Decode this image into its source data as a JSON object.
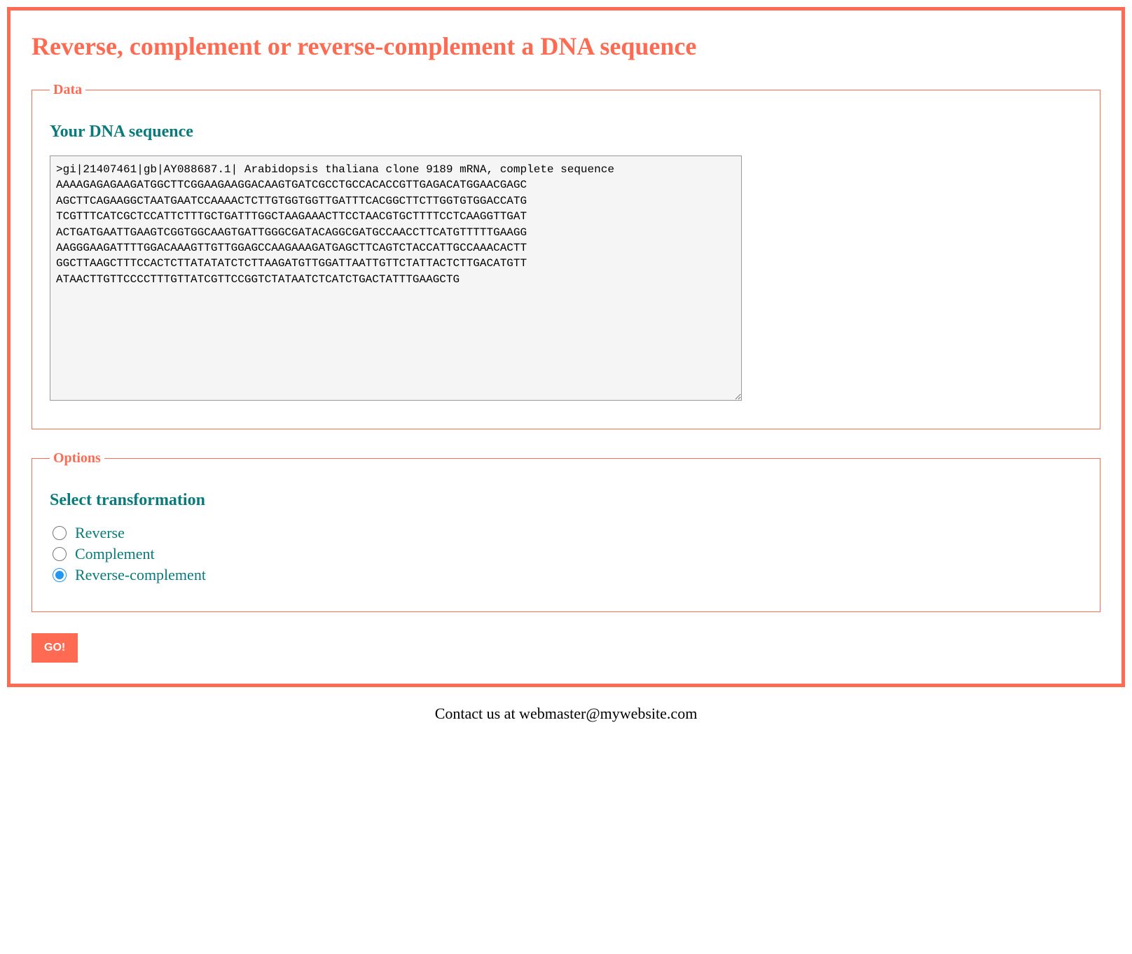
{
  "title": "Reverse, complement or reverse-complement a DNA sequence",
  "data_section": {
    "legend": "Data",
    "heading": "Your DNA sequence",
    "textarea_value": ">gi|21407461|gb|AY088687.1| Arabidopsis thaliana clone 9189 mRNA, complete sequence\nAAAAGAGAGAAGATGGCTTCGGAAGAAGGACAAGTGATCGCCTGCCACACCGTTGAGACATGGAACGAGC\nAGCTTCAGAAGGCTAATGAATCCAAAACTCTTGTGGTGGTTGATTTCACGGCTTCTTGGTGTGGACCATG\nTCGTTTCATCGCTCCATTCTTTGCTGATTTGGCTAAGAAACTTCCTAACGTGCTTTTCCTCAAGGTTGAT\nACTGATGAATTGAAGTCGGTGGCAAGTGATTGGGCGATACAGGCGATGCCAACCTTCATGTTTTTGAAGG\nAAGGGAAGATTTTGGACAAAGTTGTTGGAGCCAAGAAAGATGAGCTTCAGTCTACCATTGCCAAACACTT\nGGCTTAAGCTTTCCACTCTTATATATCTCTTAAGATGTTGGATTAATTGTTCTATTACTCTTGACATGTT\nATAACTTGTTCCCCTTTGTTATCGTTCCGGTCTATAATCTCATCTGACTATTTGAAGCTG"
  },
  "options_section": {
    "legend": "Options",
    "heading": "Select transformation",
    "options": [
      {
        "label": "Reverse",
        "value": "reverse",
        "checked": false
      },
      {
        "label": "Complement",
        "value": "complement",
        "checked": false
      },
      {
        "label": "Reverse-complement",
        "value": "revcomp",
        "checked": true
      }
    ]
  },
  "submit_label": "GO!",
  "footer": "Contact us at webmaster@mywebsite.com"
}
